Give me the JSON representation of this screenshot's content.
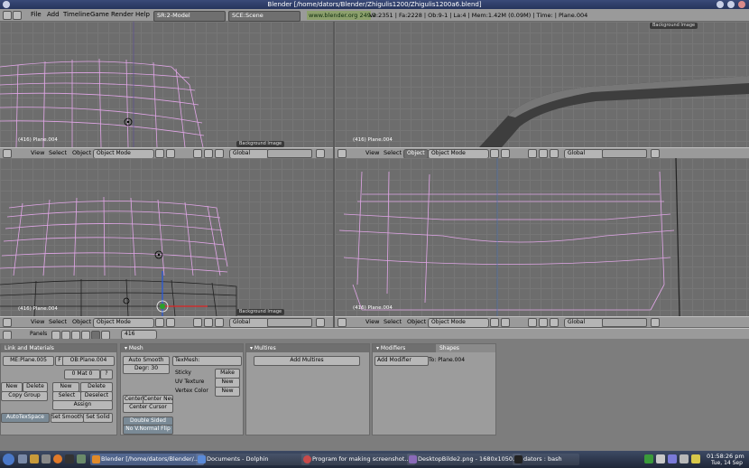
{
  "window": {
    "title": "Blender [/home/dators/Blender/Zhigulis1200/Zhigulis1200a6.blend]"
  },
  "topmenu": {
    "items": [
      "File",
      "Add",
      "Timeline",
      "Game",
      "Render",
      "Help"
    ],
    "screen": "SR:2-Model",
    "scene": "SCE:Scene",
    "website": "www.blender.org 249.2",
    "stats": "Ve:2351 | Fa:2228 | Ob:9-1 | La:4 | Mem:1.42M (0.09M) | Time: | Plane.004"
  },
  "viewport": {
    "menus": [
      "View",
      "Select",
      "Object"
    ],
    "mode": "Object Mode",
    "orientation": "Global",
    "bg_tab": "Background Image",
    "labels": [
      "(416) Plane.004",
      "(416) Plane.004",
      "(416) Plane.004",
      "(416) Plane.004"
    ]
  },
  "buttons_header": {
    "panels_label": "Panels",
    "frame": "416"
  },
  "link_panel": {
    "title": "Link and Materials",
    "me": "ME:Plane.005",
    "f": "F",
    "ob": "OB:Plane.004",
    "mat": "0 Mat 0",
    "q": "?",
    "new1": "New",
    "delete1": "Delete",
    "new2": "New",
    "delete2": "Delete",
    "copy_group": "Copy Group",
    "select": "Select",
    "deselect": "Deselect",
    "assign": "Assign",
    "autotexspace": "AutoTexSpace",
    "set_smooth": "Set Smooth",
    "set_solid": "Set Solid"
  },
  "mesh_panel": {
    "title": "Mesh",
    "auto_smooth": "Auto Smooth",
    "degr": "Degr: 30",
    "texmesh": "TexMesh:",
    "sticky": "Sticky",
    "sticky_btn": "Make",
    "uv": "UV Texture",
    "uv_btn": "New",
    "vcol": "Vertex Color",
    "vcol_btn": "New",
    "center": "Center",
    "center_new": "Center New",
    "center_cursor": "Center Cursor",
    "double_sided": "Double Sided",
    "no_vnormal": "No V.Normal Flip"
  },
  "multires_panel": {
    "title": "Multires",
    "add": "Add Multires"
  },
  "modifiers_panel": {
    "tab1": "Modifiers",
    "tab2": "Shapes",
    "add": "Add Modifier",
    "to": "To: Plane.004"
  },
  "taskbar": {
    "tasks": [
      "Blender [/home/dators/Blender/...",
      "Documents - Dolphin",
      "Program for making screenshot...",
      "DesktopBilde2.png - 1680x1050...",
      "dators : bash"
    ],
    "time": "01:58:26 pm",
    "date": "Tue, 14 Sep"
  },
  "colors": {
    "wire": "#e2a6e8",
    "accent": "#8ca06c",
    "taskbar": "#1f2738"
  }
}
